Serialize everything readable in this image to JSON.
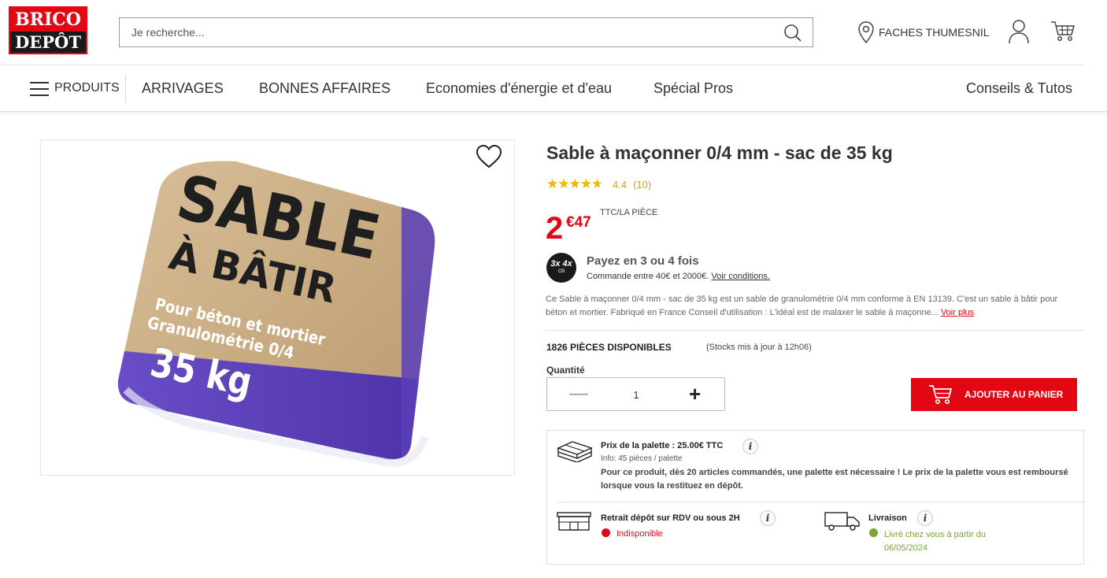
{
  "header": {
    "logo_top": "BRICO",
    "logo_bottom": "DEPÔT",
    "search_placeholder": "Je recherche...",
    "store_name": "FACHES THUMESNIL"
  },
  "nav": {
    "products": "PRODUITS",
    "items": [
      "ARRIVAGES",
      "BONNES AFFAIRES",
      "Economies d'énergie et d'eau",
      "Spécial Pros",
      "Conseils & Tutos"
    ]
  },
  "product": {
    "title": "Sable à maçonner 0/4 mm - sac de 35 kg",
    "rating": 4.4,
    "rating_text": "4.4",
    "review_count": "(10)",
    "price_int": "2",
    "price_dec": "€47",
    "price_unit": "TTC/LA PIÈCE",
    "payment": {
      "badge_top": "3x 4x",
      "badge_bottom": "CB",
      "title": "Payez en 3 ou 4 fois",
      "subtitle": "Commande entre 40€ et 2000€.",
      "link": "Voir conditions."
    },
    "description": "Ce Sable à maçonner 0/4 mm - sac de 35 kg est un sable de granulométrie 0/4 mm conforme à EN 13139. C'est un sable à bâtir pour béton et mortier. Fabriqué en France Conseil d'utilisation : L'idéal est de malaxer le sable à maçonne...",
    "read_more": "Voir plus",
    "stock": "1826 PIÈCES DISPONIBLES",
    "stock_update": "(Stocks mis à jour à 12h06)",
    "quantity_label": "Quantité",
    "quantity": "1",
    "add_to_cart": "AJOUTER AU PANIER"
  },
  "bag": {
    "line1": "SABLE",
    "line2": "À BÂTIR",
    "line3": "Pour béton et mortier",
    "line4": "Granulométrie 0/4",
    "line5": "35 kg"
  },
  "info": {
    "palette_title": "Prix de la palette : 25.00€ TTC",
    "palette_info": "Info: 45 pièces / palette",
    "palette_note": "Pour ce produit, dès 20 articles commandés, une palette est nécessaire ! Le prix de la palette vous est remboursé lorsque vous la restituez en dépôt.",
    "pickup_title": "Retrait dépôt sur RDV ou sous 2H",
    "pickup_status": "Indisponible",
    "delivery_title": "Livraison",
    "delivery_status": "Livré chez vous à partir du 06/05/2024",
    "info_glyph": "i"
  },
  "colors": {
    "brand_red": "#e30613",
    "bag_purple": "#5a3fb8",
    "available_green": "#78a43a"
  }
}
